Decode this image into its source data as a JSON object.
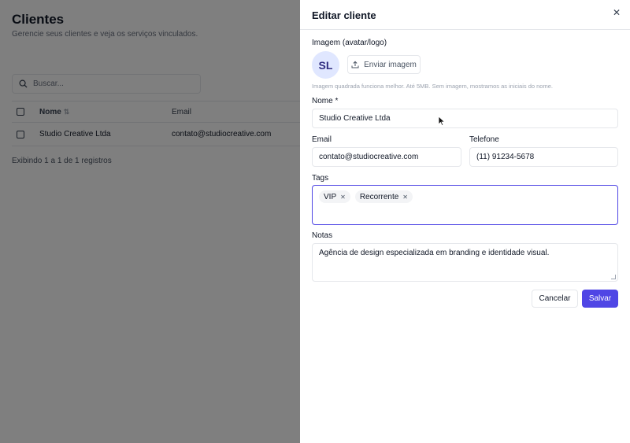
{
  "page": {
    "title": "Clientes",
    "subtitle": "Gerencie seus clientes e veja os serviços vinculados.",
    "search_placeholder": "Buscar...",
    "table": {
      "headers": {
        "name": "Nome",
        "email": "Email"
      },
      "rows": [
        {
          "name": "Studio Creative Ltda",
          "email": "contato@studiocreative.com"
        }
      ]
    },
    "footer_info": "Exibindo 1 a 1 de 1 registros"
  },
  "drawer": {
    "title": "Editar cliente",
    "close_icon": "close-icon",
    "image_label": "Imagem (avatar/logo)",
    "avatar_initials": "SL",
    "upload_label": "Enviar imagem",
    "image_hint": "Imagem quadrada funciona melhor. Até 5MB. Sem imagem, mostramos as iniciais do nome.",
    "name_label": "Nome *",
    "name_value": "Studio Creative Ltda",
    "email_label": "Email",
    "email_value": "contato@studiocreative.com",
    "phone_label": "Telefone",
    "phone_value": "(11) 91234-5678",
    "tags_label": "Tags",
    "tags": [
      "VIP",
      "Recorrente"
    ],
    "notes_label": "Notas",
    "notes_value": "Agência de design especializada em branding e identidade visual.",
    "cancel_label": "Cancelar",
    "save_label": "Salvar"
  },
  "colors": {
    "accent": "#4f46e5",
    "avatar_bg": "#e0e7ff",
    "overlay": "rgba(0,0,0,0.5)"
  }
}
